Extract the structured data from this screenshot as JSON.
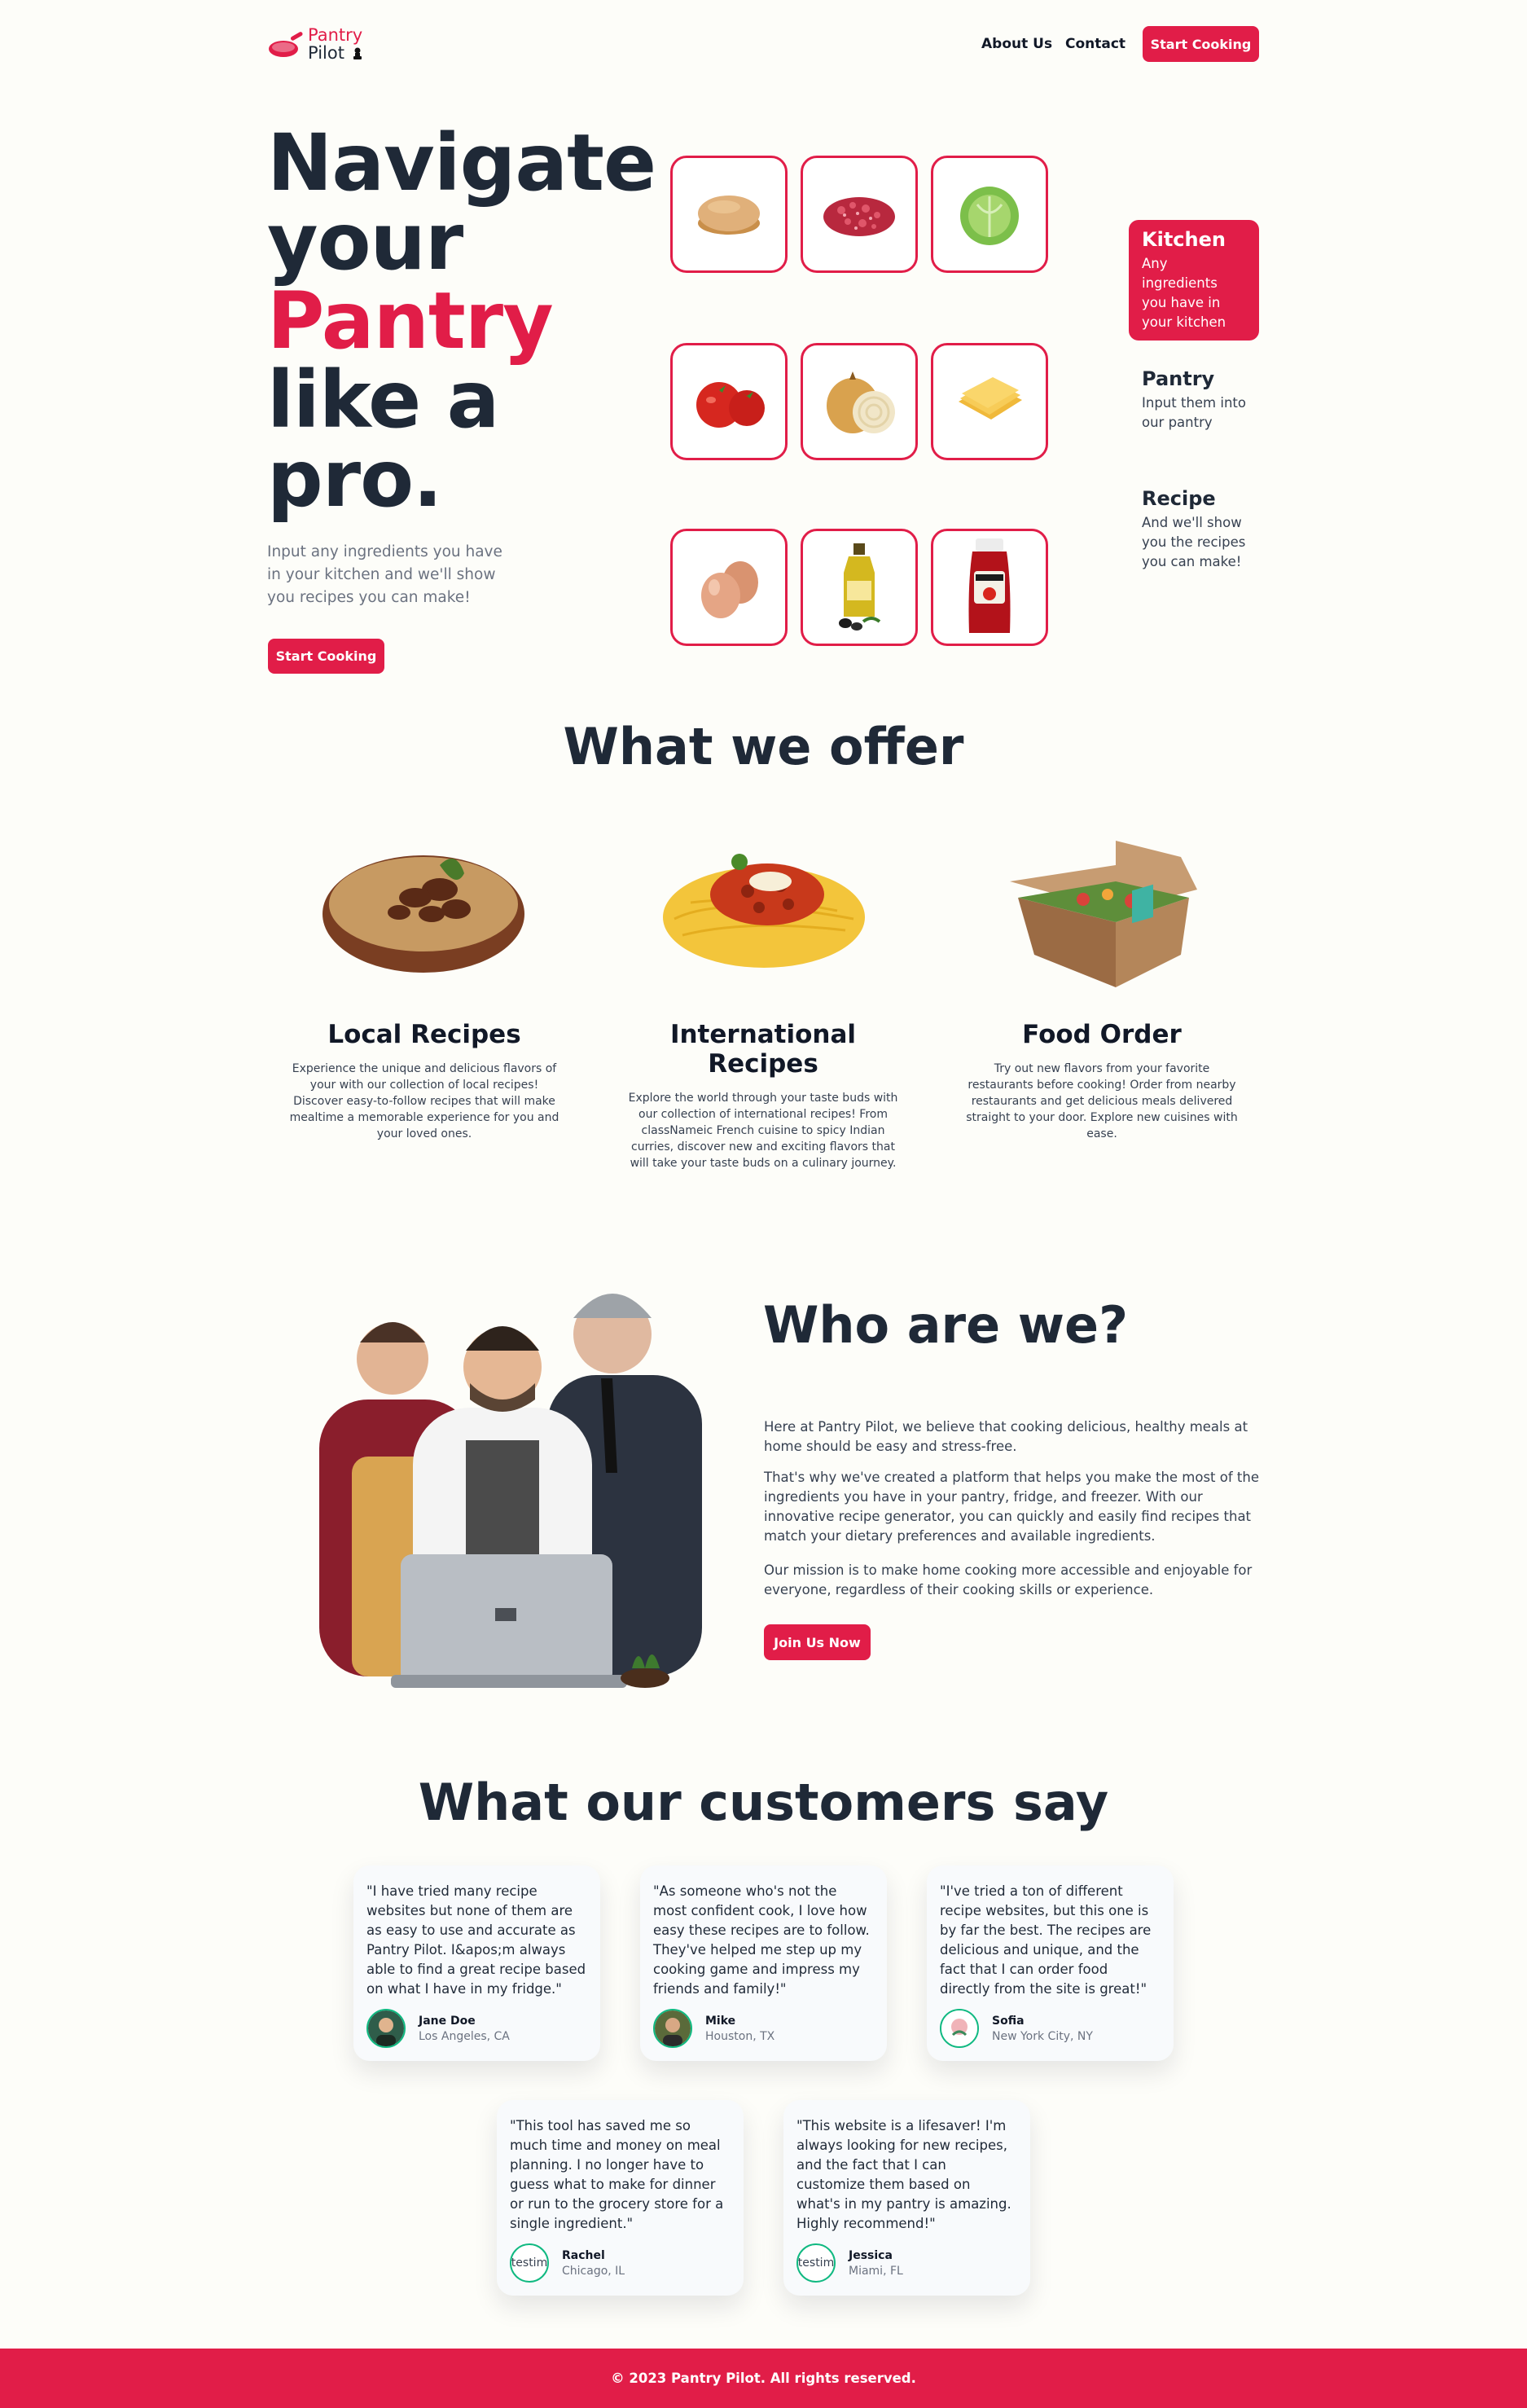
{
  "header": {
    "logo_line1": "Pantry",
    "logo_line2": "Pilot",
    "nav_about": "About Us",
    "nav_contact": "Contact",
    "cta": "Start Cooking"
  },
  "hero": {
    "title_line1": "Navigate",
    "title_line2": "your",
    "title_accent": "Pantry",
    "title_line4": "like a",
    "title_line5": "pro.",
    "subtitle": "Input any ingredients you have in your kitchen and we'll show you recipes you can make!",
    "cta": "Start Cooking",
    "ingredients": [
      "bun",
      "ground-beef",
      "lettuce",
      "tomato",
      "onion",
      "cheese",
      "eggs",
      "olive-oil",
      "ketchup"
    ]
  },
  "steps": [
    {
      "title": "Kitchen",
      "desc": "Any ingredients you have in your kitchen"
    },
    {
      "title": "Pantry",
      "desc": "Input them into our pantry"
    },
    {
      "title": "Recipe",
      "desc": "And we'll show you the recipes you can make!"
    }
  ],
  "offer": {
    "title": "What we offer",
    "cards": [
      {
        "title": "Local Recipes",
        "desc": "Experience the unique and delicious flavors of your with our collection of local recipes! Discover easy-to-follow recipes that will make mealtime a memorable experience for you and your loved ones."
      },
      {
        "title": "International Recipes",
        "desc": "Explore the world through your taste buds with our collection of international recipes! From classNameic French cuisine to spicy Indian curries, discover new and exciting flavors that will take your taste buds on a culinary journey."
      },
      {
        "title": "Food Order",
        "desc": "Try out new flavors from your favorite restaurants before cooking! Order from nearby restaurants and get delicious meals delivered straight to your door. Explore new cuisines with ease."
      }
    ]
  },
  "who": {
    "title": "Who are we?",
    "p1": "Here at Pantry Pilot, we believe that cooking delicious, healthy meals at home should be easy and stress-free.",
    "p2": "That's why we've created a platform that helps you make the most of the ingredients you have in your pantry, fridge, and freezer. With our innovative recipe generator, you can quickly and easily find recipes that match your dietary preferences and available ingredients.",
    "p3": "Our mission is to make home cooking more accessible and enjoyable for everyone, regardless of their cooking skills or experience.",
    "cta": "Join Us Now"
  },
  "testimonials": {
    "title": "What our customers say",
    "items": [
      {
        "quote": "\"I have tried many recipe websites but none of them are as easy to use and accurate as Pantry Pilot. I&apos;m always able to find a great recipe based on what I have in my fridge.\"",
        "name": "Jane Doe",
        "location": "Los Angeles, CA"
      },
      {
        "quote": "\"As someone who's not the most confident cook, I love how easy these recipes are to follow. They've helped me step up my cooking game and impress my friends and family!\"",
        "name": "Mike",
        "location": "Houston, TX"
      },
      {
        "quote": "\"I've tried a ton of different recipe websites, but this one is by far the best. The recipes are delicious and unique, and the fact that I can order food directly from the site is great!\"",
        "name": "Sofia",
        "location": "New York City, NY"
      },
      {
        "quote": "\"This tool has saved me so much time and money on meal planning. I no longer have to guess what to make for dinner or run to the grocery store for a single ingredient.\"",
        "name": "Rachel",
        "location": "Chicago, IL",
        "avatar_alt": "testim"
      },
      {
        "quote": "\"This website is a lifesaver! I'm always looking for new recipes, and the fact that I can customize them based on what's in my pantry is amazing. Highly recommend!\"",
        "name": "Jessica",
        "location": "Miami, FL",
        "avatar_alt": "testim"
      }
    ]
  },
  "footer": {
    "text": "© 2023 Pantry Pilot. All rights reserved."
  },
  "colors": {
    "accent": "#e11d48",
    "heading": "#1f2937",
    "background": "#fdfdf9"
  }
}
